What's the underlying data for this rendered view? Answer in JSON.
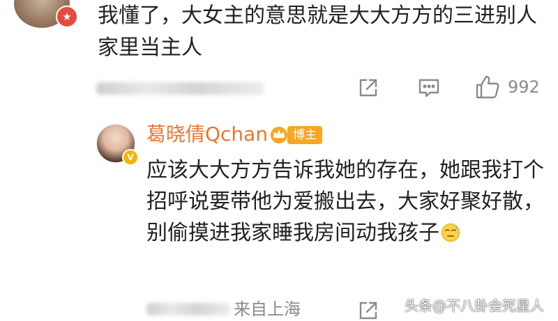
{
  "top_comment": {
    "text": "我懂了，大女主的意思就是大大方方的三进别人家里当主人",
    "like_count": "992"
  },
  "reply": {
    "username": "葛晓倩Qchan",
    "role_badge": "博主",
    "text": "应该大大方方告诉我她的存在，她跟我打个招呼说要带他为爱搬出去，大家好聚好散，别偷摸进我家睡我房间动我孩子",
    "location": "来自上海"
  },
  "watermark": "头条@不八卦会死星人",
  "icons": [
    "share-icon",
    "comment-icon",
    "like-icon",
    "crown-icon",
    "sweat-emoji-icon",
    "verified-icon"
  ],
  "colors": {
    "username": "#e8762b",
    "badge": "#f5a623",
    "meta_gray": "#8a8a8a"
  }
}
